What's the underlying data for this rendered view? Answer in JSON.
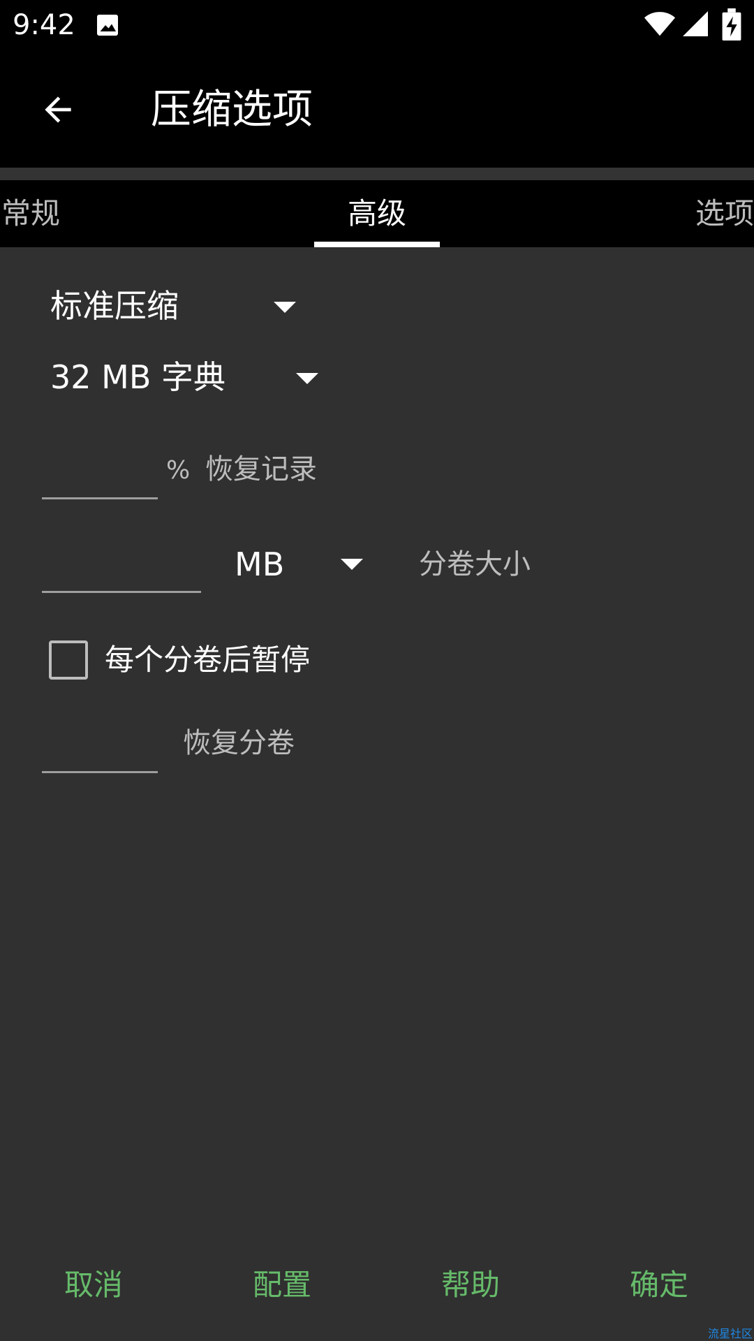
{
  "status_bar": {
    "time": "9:42",
    "icons": [
      "gallery-icon",
      "wifi-icon",
      "signal-icon",
      "battery-charging-icon"
    ]
  },
  "app_bar": {
    "title": "压缩选项",
    "back_icon": "arrow-back-icon"
  },
  "tabs": [
    {
      "label": "常规",
      "selected": false
    },
    {
      "label": "高级",
      "selected": true
    },
    {
      "label": "选项",
      "selected": false
    }
  ],
  "form": {
    "compression_method": "标准压缩",
    "dictionary_size": "32 MB 字典",
    "recovery_record": {
      "value": "",
      "unit": "%",
      "label": "恢复记录"
    },
    "volume_size": {
      "value": "",
      "unit": "MB",
      "label": "分卷大小"
    },
    "pause_after_volume": {
      "label": "每个分卷后暂停",
      "checked": false
    },
    "recovery_volumes": {
      "value": "",
      "label": "恢复分卷"
    }
  },
  "buttons": {
    "cancel": "取消",
    "config": "配置",
    "help": "帮助",
    "ok": "确定"
  },
  "watermark": "流星社区",
  "colors": {
    "background": "#303030",
    "bars": "#000000",
    "accent_text": "#66bb6a",
    "secondary_text": "#bdbdbd"
  }
}
